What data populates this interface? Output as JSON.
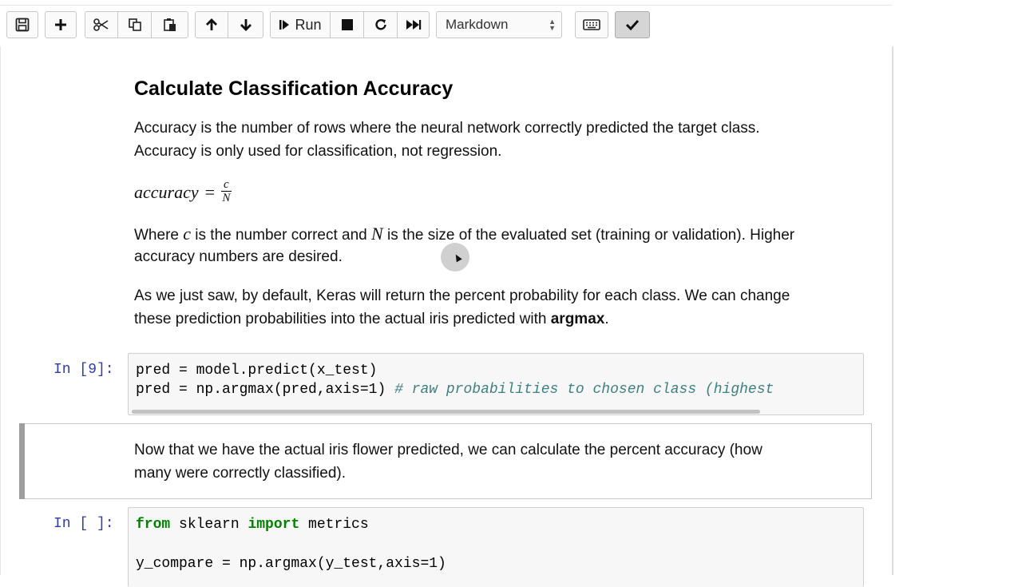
{
  "toolbar": {
    "run_label": "Run",
    "cell_type": "Markdown"
  },
  "cells": {
    "heading": "Calculate Classification Accuracy",
    "para1_line1": "Accuracy is the number of rows where the neural network correctly predicted the target class.",
    "para1_line2": "Accuracy is only used for classification, not regression.",
    "formula": {
      "lhs": "accuracy",
      "eq": "=",
      "numerator": "c",
      "denominator": "N"
    },
    "para2": {
      "where": "Where",
      "c": "c",
      "mid": "is the number correct and",
      "N": "N",
      "tail": "is the size of the evaluated set (training or validation). Higher",
      "line2": "accuracy numbers are desired."
    },
    "para3_line1": "As we just saw, by default, Keras will return the percent probability for each class. We can change",
    "para3_line2_pre": "these prediction probabilities into the actual iris predicted with ",
    "para3_line2_bold": "argmax",
    "para3_line2_post": ".",
    "code1": {
      "prompt": "In [9]:",
      "line1": "pred = model.predict(x_test)",
      "line2_code": "pred = np.argmax(pred,axis=1) ",
      "line2_comment": "# raw probabilities to chosen class (highest"
    },
    "md2_line1": "Now that we have the actual iris flower predicted, we can calculate the percent accuracy (how",
    "md2_line2": "many were correctly classified).",
    "code2": {
      "prompt": "In [ ]:",
      "kw_from": "from",
      "mod": " sklearn ",
      "kw_import": "import",
      "imp": " metrics",
      "line3": "y_compare = np.argmax(y_test,axis=1)"
    }
  }
}
